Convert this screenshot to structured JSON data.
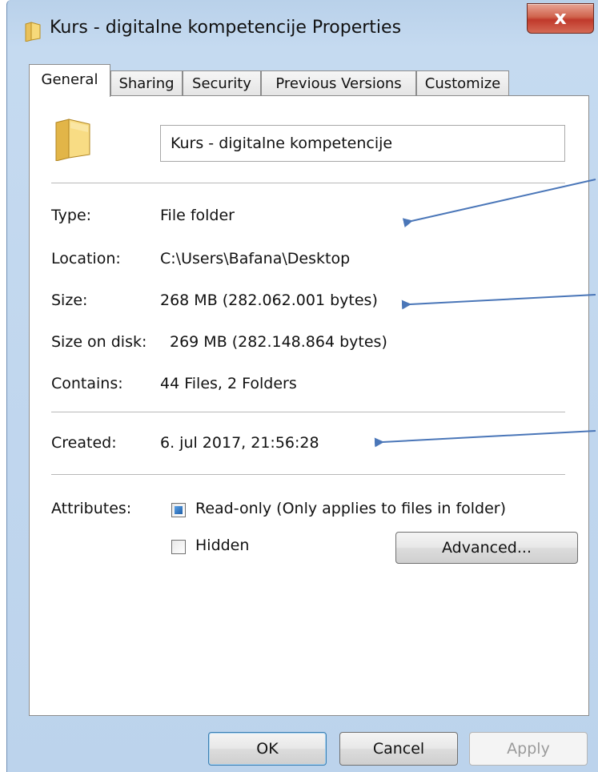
{
  "window": {
    "title": "Kurs - digitalne kompetencije Properties",
    "close_symbol": "x"
  },
  "tabs": [
    {
      "label": "General",
      "active": true
    },
    {
      "label": "Sharing",
      "active": false
    },
    {
      "label": "Security",
      "active": false
    },
    {
      "label": "Previous Versions",
      "active": false
    },
    {
      "label": "Customize",
      "active": false
    }
  ],
  "general": {
    "folder_name": "Kurs - digitalne kompetencije",
    "rows": {
      "type": {
        "label": "Type:",
        "value": "File folder"
      },
      "location": {
        "label": "Location:",
        "value": "C:\\Users\\Bafana\\Desktop"
      },
      "size": {
        "label": "Size:",
        "value": "268 MB (282.062.001 bytes)"
      },
      "size_on_disk": {
        "label": "Size on disk:",
        "value": "269 MB (282.148.864 bytes)"
      },
      "contains": {
        "label": "Contains:",
        "value": "44 Files, 2 Folders"
      },
      "created": {
        "label": "Created:",
        "value": "6. jul 2017, 21:56:28"
      }
    },
    "attributes": {
      "label": "Attributes:",
      "read_only": {
        "label": "Read-only (Only applies to files in folder)",
        "state": "indeterminate"
      },
      "hidden": {
        "label": "Hidden",
        "state": "unchecked"
      },
      "advanced_label": "Advanced..."
    }
  },
  "footer": {
    "ok_label": "OK",
    "cancel_label": "Cancel",
    "apply_label": "Apply"
  },
  "colors": {
    "annotation_arrow": "#4a76b8",
    "title_bar": "#c5daf0",
    "close_button": "#c0392b"
  }
}
